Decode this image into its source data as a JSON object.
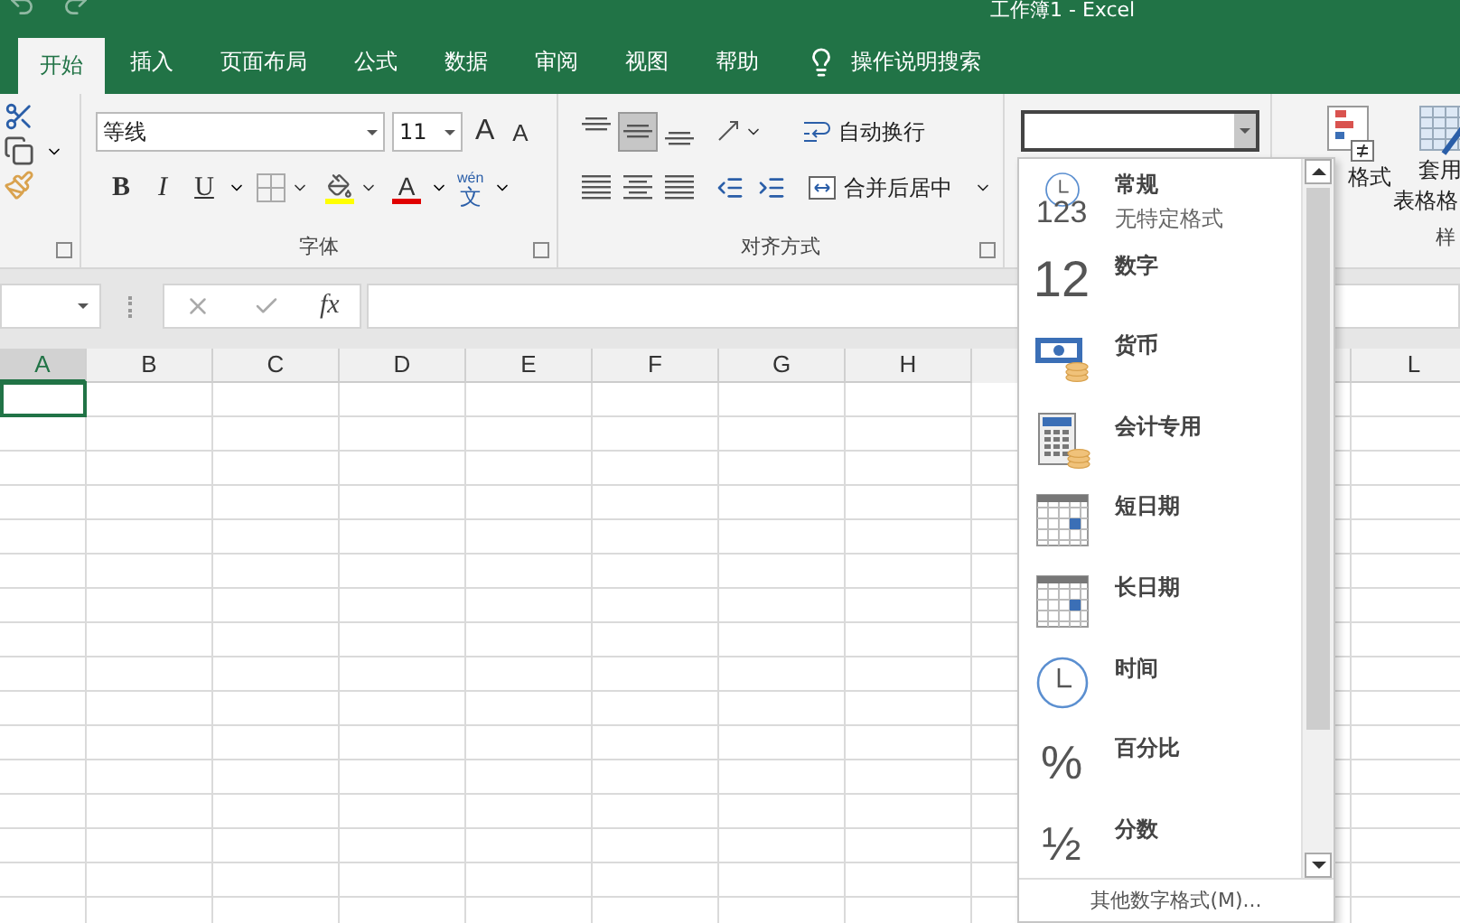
{
  "window": {
    "title": "工作簿1  -  Excel"
  },
  "tabs": [
    {
      "label": "开始",
      "selected": true
    },
    {
      "label": "插入",
      "selected": false
    },
    {
      "label": "页面布局",
      "selected": false
    },
    {
      "label": "公式",
      "selected": false
    },
    {
      "label": "数据",
      "selected": false
    },
    {
      "label": "审阅",
      "selected": false
    },
    {
      "label": "视图",
      "selected": false
    },
    {
      "label": "帮助",
      "selected": false
    }
  ],
  "tell_me": "操作说明搜索",
  "font": {
    "label": "字体",
    "name": "等线",
    "size": "11",
    "grow": "A",
    "shrink": "A",
    "styles": [
      {
        "kind": "bold",
        "glyph": "B"
      },
      {
        "kind": "italic",
        "glyph": "I"
      },
      {
        "kind": "underline",
        "glyph": "U"
      }
    ],
    "color_glyph": "A",
    "phonetic_top": "wén",
    "phonetic_bottom": "文"
  },
  "alignment": {
    "label": "对齐方式",
    "wrap": "自动换行",
    "merge": "合并后居中",
    "buttons": [
      {
        "kind": "top",
        "selected": false
      },
      {
        "kind": "middle",
        "selected": true
      },
      {
        "kind": "bottom",
        "selected": false
      },
      {
        "kind": "left",
        "selected": false
      },
      {
        "kind": "center",
        "selected": false
      },
      {
        "kind": "right",
        "selected": false
      },
      {
        "kind": "outdent",
        "selected": false
      },
      {
        "kind": "indent",
        "selected": false
      }
    ]
  },
  "styles": {
    "conditional": "格式",
    "table_top": "套用",
    "table_bottom": "表格格",
    "label": "样"
  },
  "formula_bar": {
    "fx": "fx"
  },
  "columns": [
    {
      "label": "A",
      "selected": true
    },
    {
      "label": "B",
      "selected": false
    },
    {
      "label": "C",
      "selected": false
    },
    {
      "label": "D",
      "selected": false
    },
    {
      "label": "E",
      "selected": false
    },
    {
      "label": "F",
      "selected": false
    },
    {
      "label": "G",
      "selected": false
    },
    {
      "label": "H",
      "selected": false
    }
  ],
  "right_columns": [
    {
      "label": "L",
      "selected": false
    }
  ],
  "number_menu": {
    "items": [
      {
        "kind": "general",
        "glyph": "123",
        "label": "常规",
        "sub": "无特定格式"
      },
      {
        "kind": "number",
        "glyph": "12",
        "label": "数字"
      },
      {
        "kind": "currency",
        "label": "货币"
      },
      {
        "kind": "accounting",
        "label": "会计专用"
      },
      {
        "kind": "short_date",
        "label": "短日期"
      },
      {
        "kind": "long_date",
        "label": "长日期"
      },
      {
        "kind": "time",
        "label": "时间"
      },
      {
        "kind": "percent",
        "glyph": "%",
        "label": "百分比"
      },
      {
        "kind": "fraction",
        "glyph": "½",
        "label": "分数"
      }
    ],
    "more": "其他数字格式(M)..."
  }
}
